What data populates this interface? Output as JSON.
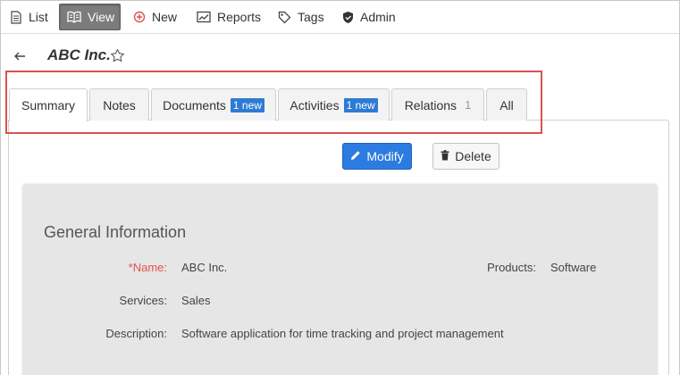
{
  "toolbar": {
    "list": "List",
    "view": "View",
    "new": "New",
    "reports": "Reports",
    "tags": "Tags",
    "admin": "Admin"
  },
  "record": {
    "title": "ABC Inc."
  },
  "tabs": [
    {
      "label": "Summary",
      "active": true
    },
    {
      "label": "Notes"
    },
    {
      "label": "Documents",
      "badge": "1 new"
    },
    {
      "label": "Activities",
      "badge": "1 new"
    },
    {
      "label": "Relations",
      "count": "1"
    },
    {
      "label": "All"
    }
  ],
  "actions": {
    "modify": "Modify",
    "delete": "Delete"
  },
  "general": {
    "heading": "General Information",
    "fields": {
      "name_label": "*Name:",
      "name_value": "ABC Inc.",
      "products_label": "Products:",
      "products_value": "Software",
      "services_label": "Services:",
      "services_value": "Sales",
      "description_label": "Description:",
      "description_value": "Software application for time tracking and project management"
    }
  },
  "colors": {
    "accent": "#2c7be0",
    "highlight": "#d9534f",
    "required": "#e0544e",
    "badge": "#2d7bd4"
  }
}
